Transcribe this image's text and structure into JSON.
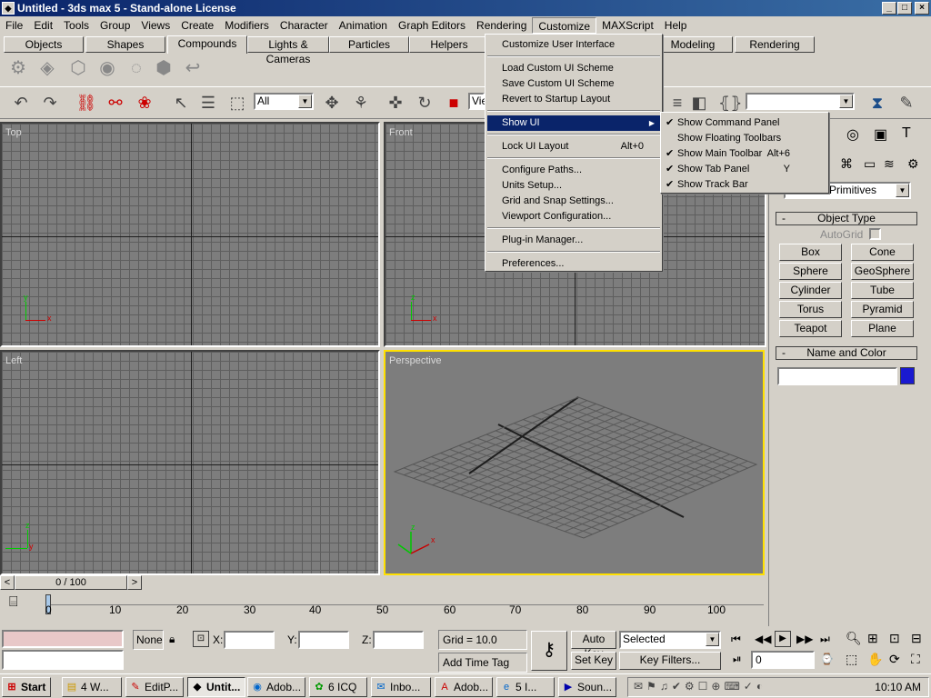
{
  "window": {
    "title": "Untitled - 3ds max 5 - Stand-alone License",
    "min": "_",
    "max": "□",
    "close": "×"
  },
  "menubar": [
    "File",
    "Edit",
    "Tools",
    "Group",
    "Views",
    "Create",
    "Modifiers",
    "Character",
    "Animation",
    "Graph Editors",
    "Rendering",
    "Customize",
    "MAXScript",
    "Help"
  ],
  "tabs": [
    "Objects",
    "Shapes",
    "Compounds",
    "Lights & Cameras",
    "Particles",
    "Helpers",
    "Modeling",
    "Rendering"
  ],
  "toolbar": {
    "selection_filter": "All",
    "ref_coord": "Vie",
    "named_sel": ""
  },
  "viewports": {
    "top": "Top",
    "front": "Front",
    "left": "Left",
    "perspective": "Perspective"
  },
  "axes": {
    "x": "x",
    "y": "y",
    "z": "z"
  },
  "command_panel": {
    "category": "Primitives",
    "object_type_title": "Object Type",
    "autogrid": "AutoGrid",
    "buttons": [
      "Box",
      "Cone",
      "Sphere",
      "GeoSphere",
      "Cylinder",
      "Tube",
      "Torus",
      "Pyramid",
      "Teapot",
      "Plane"
    ],
    "name_color_title": "Name and Color",
    "object_color": "#1a1ad0",
    "rollout_toggle": "-"
  },
  "timeline": {
    "frame": "0 / 100",
    "ticks": [
      "0",
      "10",
      "20",
      "30",
      "40",
      "50",
      "60",
      "70",
      "80",
      "90",
      "100"
    ]
  },
  "status": {
    "none": "None",
    "x": "X:",
    "y": "Y:",
    "z": "Z:",
    "grid": "Grid = 10.0",
    "add_time_tag": "Add Time Tag",
    "auto_key": "Auto Key",
    "set_key": "Set Key",
    "key_mode": "Selected",
    "key_filters": "Key Filters...",
    "current_frame": "0"
  },
  "taskbar": {
    "start": "Start",
    "items": [
      {
        "label": "4 W...",
        "icon": "folder-icon"
      },
      {
        "label": "EditP...",
        "icon": "edit-icon"
      },
      {
        "label": "Untit...",
        "icon": "max-icon"
      },
      {
        "label": "Adob...",
        "icon": "adobe-icon"
      },
      {
        "label": "6 ICQ",
        "icon": "icq-icon"
      },
      {
        "label": "Inbo...",
        "icon": "mail-icon"
      },
      {
        "label": "Adob...",
        "icon": "acrobat-icon"
      },
      {
        "label": "5 I...",
        "icon": "ie-icon"
      },
      {
        "label": "Soun...",
        "icon": "sound-icon"
      }
    ],
    "clock": "10:10 AM"
  },
  "customize_menu": [
    {
      "label": "Customize User Interface"
    },
    {
      "sep": true
    },
    {
      "label": "Load Custom UI Scheme"
    },
    {
      "label": "Save Custom UI Scheme"
    },
    {
      "label": "Revert to Startup Layout"
    },
    {
      "sep": true
    },
    {
      "label": "Show UI",
      "submenu": true,
      "highlight": true
    },
    {
      "sep": true
    },
    {
      "label": "Lock UI Layout",
      "shortcut": "Alt+0"
    },
    {
      "sep": true
    },
    {
      "label": "Configure Paths..."
    },
    {
      "label": "Units Setup..."
    },
    {
      "label": "Grid and Snap Settings..."
    },
    {
      "label": "Viewport Configuration..."
    },
    {
      "sep": true
    },
    {
      "label": "Plug-in Manager..."
    },
    {
      "sep": true
    },
    {
      "label": "Preferences..."
    }
  ],
  "show_ui_menu": [
    {
      "label": "Show Command Panel",
      "checked": true,
      "shortcut": ""
    },
    {
      "label": "Show Floating Toolbars",
      "checked": false,
      "shortcut": ""
    },
    {
      "label": "Show Main Toolbar",
      "checked": true,
      "shortcut": "Alt+6"
    },
    {
      "label": "Show Tab Panel",
      "checked": true,
      "shortcut": "Y"
    },
    {
      "label": "Show Track Bar",
      "checked": true,
      "shortcut": ""
    }
  ]
}
